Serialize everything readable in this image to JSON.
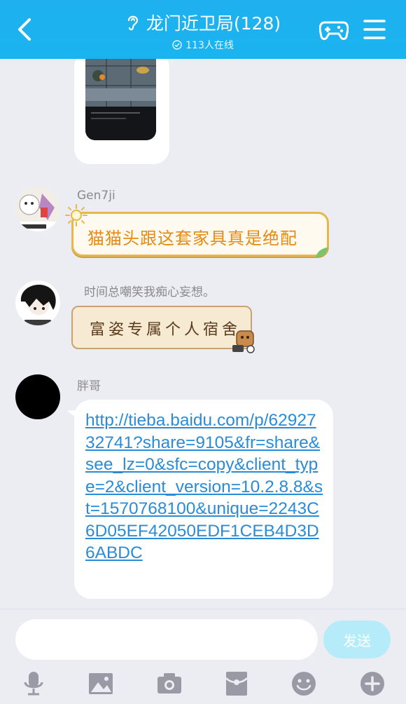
{
  "header": {
    "title": "龙门近卫局(128)",
    "online": "113人在线"
  },
  "messages": [
    {
      "type": "image"
    },
    {
      "sender": "Gen7ji",
      "text": "猫猫头跟这套家具真是绝配"
    },
    {
      "sender": "时间总嘲笑我痴心妄想。",
      "text": "富姿专属个人宿舍"
    },
    {
      "sender": "胖哥",
      "text": "http://tieba.baidu.com/p/6292732741?share=9105&fr=share&see_lz=0&sfc=copy&client_type=2&client_version=10.2.8.8&st=1570768100&unique=2243C6D05EF42050EDF1CEB4D3D6ABDC"
    }
  ],
  "input": {
    "placeholder": "",
    "send_label": "发送"
  },
  "toolbar": [
    "microphone-icon",
    "image-icon",
    "camera-icon",
    "red-packet-icon",
    "emoji-icon",
    "plus-icon"
  ],
  "colors": {
    "header": "#1fb0ef",
    "link": "#2a8cd6",
    "background": "#ececf3",
    "send_button": "#b6ecf9"
  }
}
